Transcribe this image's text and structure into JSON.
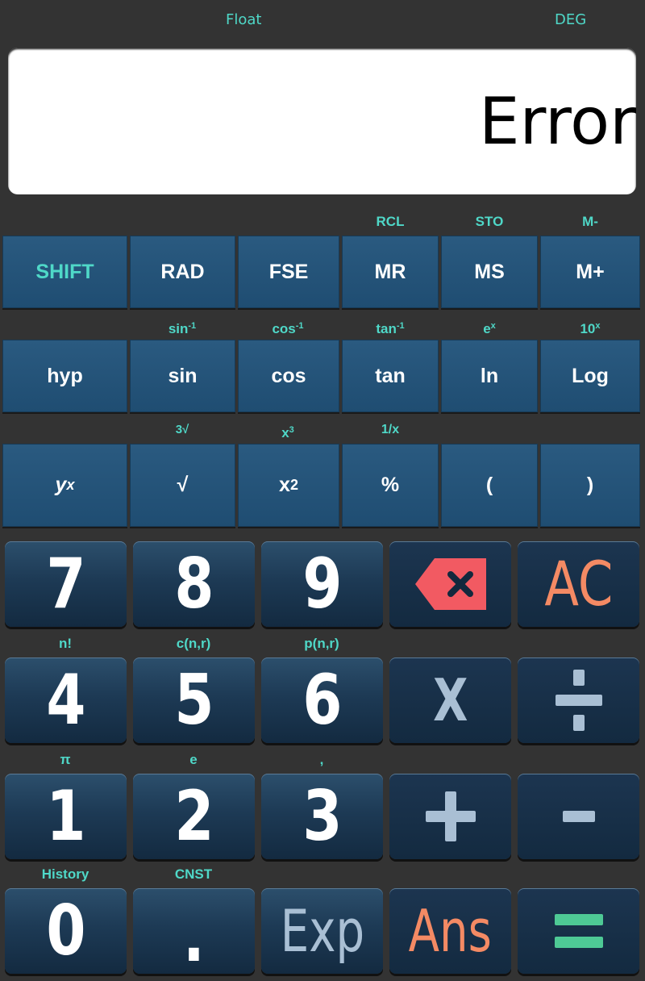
{
  "status": {
    "mode": "Float",
    "angle": "DEG"
  },
  "display": {
    "value": "Error"
  },
  "row1_labels": {
    "mr": "RCL",
    "ms": "STO",
    "mplus": "M-"
  },
  "row1": {
    "shift": "SHIFT",
    "rad": "RAD",
    "fse": "FSE",
    "mr": "MR",
    "ms": "MS",
    "mplus": "M+"
  },
  "row2_labels": {
    "sin": "sin",
    "cos": "cos",
    "tan": "tan",
    "inv": "-1",
    "exp_base": "e",
    "exp_sup": "x",
    "ten_base": "10",
    "ten_sup": "x"
  },
  "row2": {
    "hyp": "hyp",
    "sin": "sin",
    "cos": "cos",
    "tan": "tan",
    "ln": "ln",
    "log": "Log"
  },
  "row3_labels": {
    "cbrt": "3√",
    "cube_base": "x",
    "cube_sup": "3",
    "recip": "1/x"
  },
  "row3": {
    "pow_base": "y",
    "pow_sup": "x",
    "sqrt": "√",
    "sq_base": "x",
    "sq_sup": "2",
    "percent": "%",
    "lparen": "(",
    "rparen": ")"
  },
  "digits": {
    "d7": "7",
    "d8": "8",
    "d9": "9",
    "d4": "4",
    "d5": "5",
    "d6": "6",
    "d1": "1",
    "d2": "2",
    "d3": "3",
    "d0": "0",
    "dot": "."
  },
  "ops": {
    "ac": "AC",
    "multiply": "X",
    "exp": "Exp",
    "ans": "Ans"
  },
  "num_labels": {
    "fact": "n!",
    "comb": "c(n,r)",
    "perm": "p(n,r)",
    "pi": "π",
    "e": "e",
    "comma": ",",
    "history": "History",
    "cnst": "CNST"
  },
  "icons": {
    "backspace": "backspace-icon",
    "divide": "divide-icon",
    "plus": "plus-icon",
    "minus": "minus-icon",
    "equals": "equals-icon"
  },
  "colors": {
    "accent": "#4fd8c8",
    "warning": "#f48a64",
    "key": "#1f4d72"
  }
}
